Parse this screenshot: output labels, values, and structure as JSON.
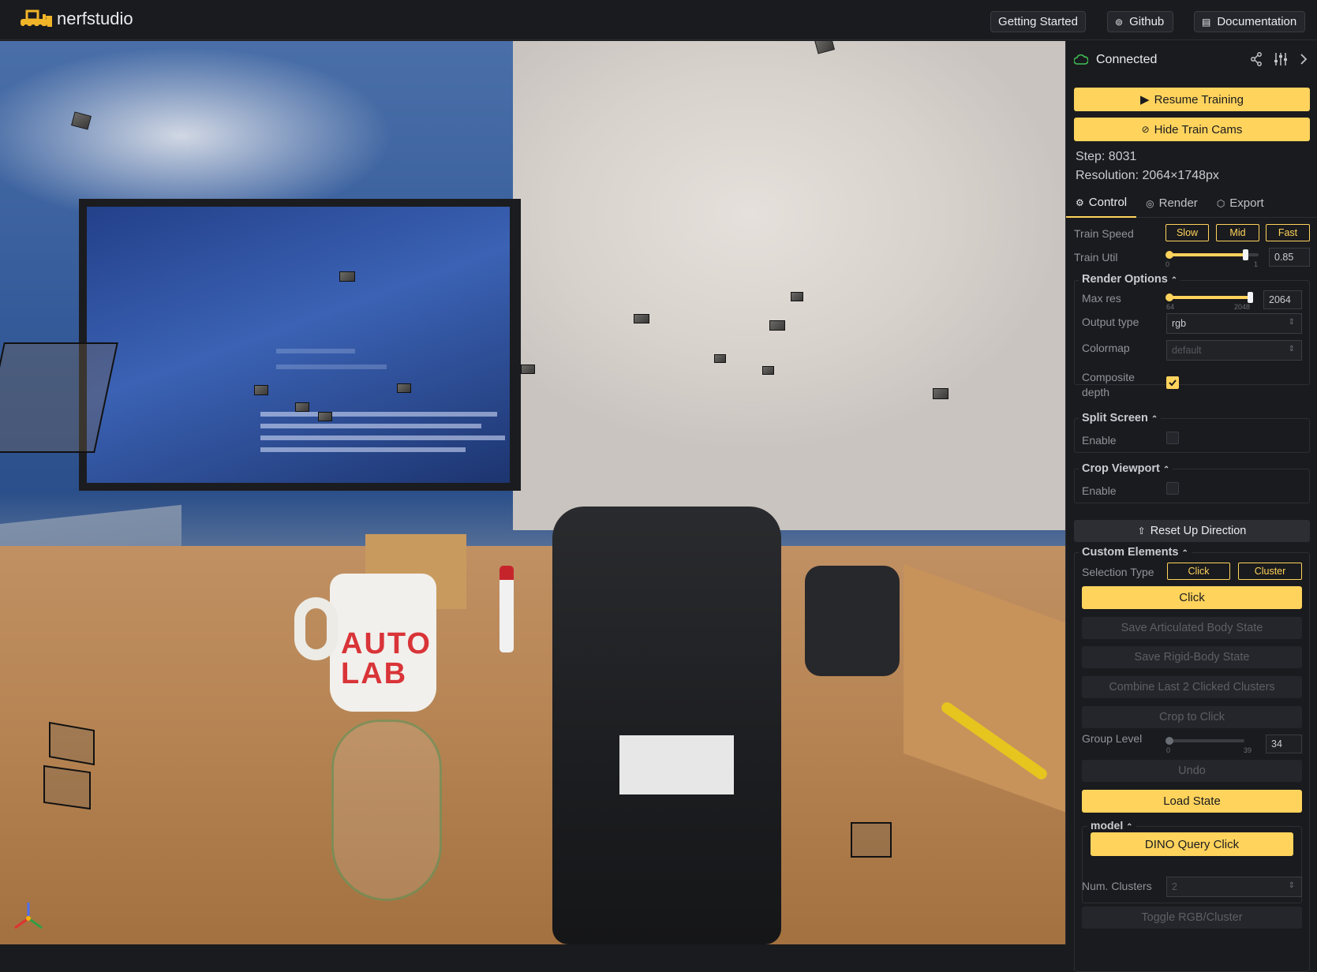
{
  "app": {
    "name": "nerfstudio"
  },
  "nav": {
    "getting_started": "Getting Started",
    "github": "Github",
    "documentation": "Documentation"
  },
  "status": {
    "connection": "Connected"
  },
  "actions": {
    "resume_training": "Resume Training",
    "hide_train_cams": "Hide Train Cams"
  },
  "info": {
    "step": "Step: 8031",
    "resolution": "Resolution: 2064×1748px"
  },
  "tabs": [
    {
      "label": "Control",
      "active": true
    },
    {
      "label": "Render",
      "active": false
    },
    {
      "label": "Export",
      "active": false
    }
  ],
  "control": {
    "train_speed": {
      "label": "Train Speed",
      "options": [
        "Slow",
        "Mid",
        "Fast"
      ]
    },
    "train_util": {
      "label": "Train Util",
      "min": "0",
      "max": "1",
      "value": "0.85",
      "fraction": 0.85
    }
  },
  "render_options": {
    "title": "Render Options",
    "max_res": {
      "label": "Max res",
      "min": "64",
      "max": "2048",
      "value": "2064",
      "fraction": 1.0
    },
    "output_type": {
      "label": "Output type",
      "value": "rgb"
    },
    "colormap": {
      "label": "Colormap",
      "value": "default",
      "disabled": true
    },
    "composite_depth": {
      "label_line1": "Composite",
      "label_line2": "depth",
      "checked": true
    }
  },
  "split_screen": {
    "title": "Split Screen",
    "enable_label": "Enable",
    "checked": false
  },
  "crop_viewport": {
    "title": "Crop Viewport",
    "enable_label": "Enable",
    "checked": false
  },
  "reset_up_direction": "Reset Up Direction",
  "custom_elements": {
    "title": "Custom Elements",
    "selection_type": {
      "label": "Selection Type",
      "options": [
        "Click",
        "Cluster"
      ]
    },
    "click_button": "Click",
    "save_articulated": "Save Articulated Body State",
    "save_rigid": "Save Rigid-Body State",
    "combine_clusters": "Combine Last 2 Clicked Clusters",
    "crop_to_click": "Crop to Click",
    "group_level": {
      "label": "Group Level",
      "min": "0",
      "max": "39",
      "value": "34",
      "fraction": 0.0
    },
    "undo": "Undo",
    "load_state": "Load State",
    "model": {
      "title": "model",
      "dino_query": "DINO Query Click"
    },
    "num_clusters": {
      "label": "Num. Clusters",
      "value": "2"
    },
    "toggle_rgb": "Toggle RGB/Cluster"
  },
  "scene": {
    "mug_text_line1": "AUTO",
    "mug_text_line2": "LAB"
  },
  "colors": {
    "accent": "#ffd35c",
    "background": "#1a1b1e",
    "connected": "#40c057"
  }
}
